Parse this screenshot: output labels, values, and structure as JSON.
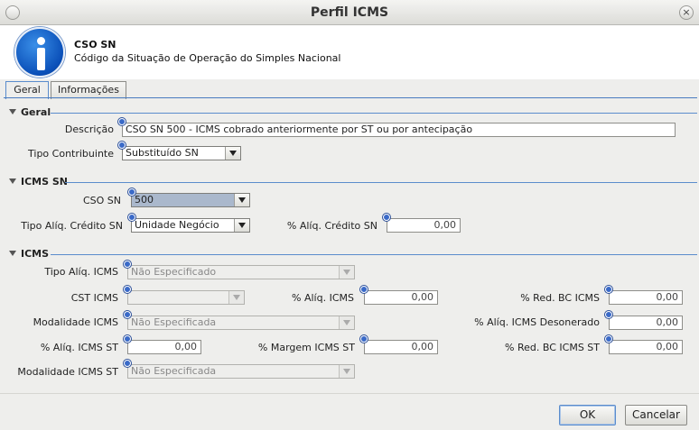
{
  "window": {
    "title": "Perfil ICMS",
    "close_glyph": "×"
  },
  "header": {
    "title": "CSO SN",
    "subtitle": "Código da Situação de Operação do Simples Nacional",
    "icon": "info-icon"
  },
  "tabs": [
    {
      "label": "Geral",
      "active": true
    },
    {
      "label": "Informações",
      "active": false
    }
  ],
  "sections": {
    "geral": {
      "title": "Geral",
      "descricao": {
        "label": "Descrição",
        "value": "CSO SN 500 - ICMS cobrado anteriormente por ST ou por antecipação"
      },
      "tipo_contribuinte": {
        "label": "Tipo Contribuinte",
        "value": "Substituído SN"
      }
    },
    "icms_sn": {
      "title": "ICMS SN",
      "cso_sn": {
        "label": "CSO SN",
        "value": "500"
      },
      "tipo_aliq_credito": {
        "label": "Tipo Alíq. Crédito SN",
        "value": "Unidade Negócio"
      },
      "aliq_credito": {
        "label": "% Alíq. Crédito SN",
        "value": "0,00"
      }
    },
    "icms": {
      "title": "ICMS",
      "tipo_aliq_icms": {
        "label": "Tipo Alíq. ICMS",
        "value": "Não Especificado"
      },
      "cst_icms": {
        "label": "CST ICMS",
        "value": ""
      },
      "aliq_icms": {
        "label": "% Alíq. ICMS",
        "value": "0,00"
      },
      "red_bc_icms": {
        "label": "% Red. BC ICMS",
        "value": "0,00"
      },
      "modalidade_icms": {
        "label": "Modalidade ICMS",
        "value": "Não Especificada"
      },
      "aliq_icms_desonerado": {
        "label": "% Alíq. ICMS Desonerado",
        "value": "0,00"
      },
      "aliq_icms_st": {
        "label": "% Alíq. ICMS ST",
        "value": "0,00"
      },
      "margem_icms_st": {
        "label": "% Margem ICMS ST",
        "value": "0,00"
      },
      "red_bc_icms_st": {
        "label": "% Red. BC ICMS ST",
        "value": "0,00"
      },
      "modalidade_icms_st": {
        "label": "Modalidade ICMS ST",
        "value": "Não Especificada"
      }
    }
  },
  "buttons": {
    "ok": "OK",
    "cancel": "Cancelar"
  },
  "colors": {
    "accent": "#4a7cc0",
    "required_marker": "#3a6ac8",
    "info_icon": "#0a4fb8"
  }
}
